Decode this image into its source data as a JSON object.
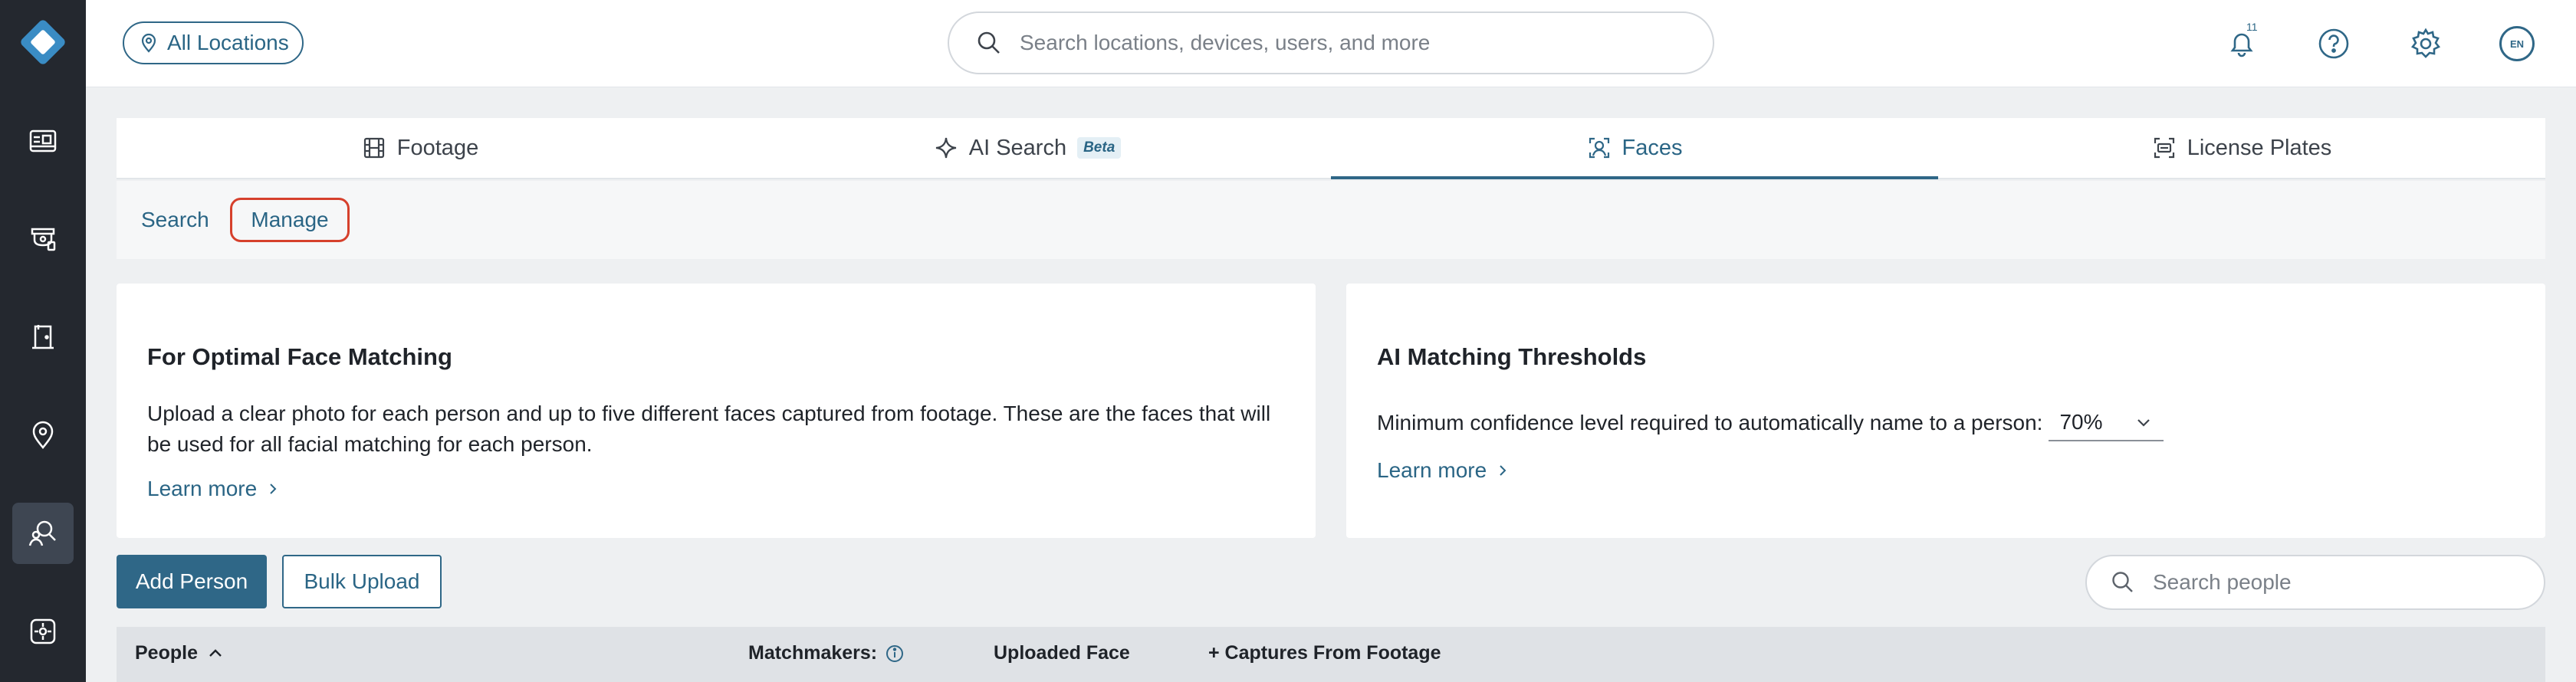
{
  "header": {
    "location_label": "All Locations",
    "search_placeholder": "Search locations, devices, users, and more",
    "notification_count": "11",
    "language": "EN"
  },
  "sidebar": {
    "items": [
      {
        "icon": "dashboard-icon"
      },
      {
        "icon": "camera-icon"
      },
      {
        "icon": "access-door-icon"
      },
      {
        "icon": "location-pin-icon"
      },
      {
        "icon": "people-search-icon",
        "active": true
      },
      {
        "icon": "integrations-icon"
      }
    ]
  },
  "tabs": [
    {
      "label": "Footage",
      "icon": "film-icon"
    },
    {
      "label": "AI Search",
      "icon": "sparkle-icon",
      "badge": "Beta"
    },
    {
      "label": "Faces",
      "icon": "face-scan-icon",
      "active": true
    },
    {
      "label": "License Plates",
      "icon": "plate-scan-icon"
    }
  ],
  "subtabs": {
    "search": "Search",
    "manage": "Manage"
  },
  "optimal_card": {
    "title": "For Optimal Face Matching",
    "body": "Upload a clear photo for each person and up to five different faces captured from footage. These are the faces that will be used for all facial matching for each person.",
    "learn_more": "Learn more"
  },
  "threshold_card": {
    "title": "AI Matching Thresholds",
    "label": "Minimum confidence level required to automatically name to a person:",
    "value": "70%",
    "learn_more": "Learn more"
  },
  "actions": {
    "add_person": "Add Person",
    "bulk_upload": "Bulk Upload",
    "search_people_placeholder": "Search people"
  },
  "table": {
    "columns": [
      "People",
      "Matchmakers:",
      "Uploaded Face",
      "+ Captures From Footage"
    ]
  },
  "colors": {
    "accent": "#2f6787",
    "sidebar": "#24282f",
    "highlight": "#d6402c"
  }
}
